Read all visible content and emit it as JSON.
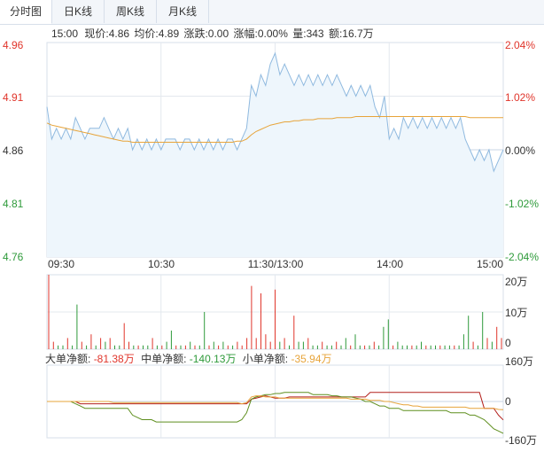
{
  "tabs": [
    {
      "label": "分时图",
      "active": true
    },
    {
      "label": "日K线",
      "active": false
    },
    {
      "label": "周K线",
      "active": false
    },
    {
      "label": "月K线",
      "active": false
    }
  ],
  "info": {
    "time": "15:00",
    "price": "现价:4.86",
    "avg": "均价:4.89",
    "change": "涨跌:0.00",
    "pct": "涨幅:0.00%",
    "volume": "量:343",
    "amount": "额:16.7万"
  },
  "flow": {
    "large_label": "大单净额:",
    "large_value": "-81.38万",
    "medium_label": "中单净额:",
    "medium_value": "-140.13万",
    "small_label": "小单净额:",
    "small_value": "-35.94万"
  },
  "colors": {
    "up": "#e0352b",
    "down": "#2e9a3a",
    "price_line": "#8fb9df",
    "avg_line": "#e7a43a",
    "area": "#eef6fc",
    "grid": "#e3e8ee",
    "large": "#b3201c",
    "medium": "#5f8f1f",
    "small": "#e7a43a"
  },
  "chart_data": [
    {
      "type": "line",
      "name": "price",
      "ylim": [
        4.76,
        4.96
      ],
      "ticks_left": [
        "4.96",
        "4.91",
        "4.86",
        "4.81",
        "4.76"
      ],
      "ticks_right": [
        "2.04%",
        "1.02%",
        "0.00%",
        "-1.02%",
        "-2.04%"
      ],
      "x_labels": [
        "09:30",
        "10:30",
        "11:30/13:00",
        "14:00",
        "15:00"
      ],
      "prev_close": 4.86,
      "price": [
        4.9,
        4.87,
        4.88,
        4.87,
        4.88,
        4.87,
        4.89,
        4.88,
        4.87,
        4.88,
        4.88,
        4.88,
        4.89,
        4.88,
        4.87,
        4.88,
        4.87,
        4.88,
        4.86,
        4.87,
        4.86,
        4.87,
        4.86,
        4.87,
        4.86,
        4.87,
        4.87,
        4.87,
        4.86,
        4.87,
        4.87,
        4.86,
        4.87,
        4.86,
        4.87,
        4.86,
        4.87,
        4.86,
        4.87,
        4.87,
        4.86,
        4.87,
        4.88,
        4.92,
        4.91,
        4.93,
        4.92,
        4.94,
        4.95,
        4.93,
        4.94,
        4.93,
        4.92,
        4.93,
        4.92,
        4.93,
        4.92,
        4.93,
        4.92,
        4.93,
        4.92,
        4.93,
        4.92,
        4.91,
        4.92,
        4.91,
        4.92,
        4.91,
        4.92,
        4.9,
        4.89,
        4.91,
        4.87,
        4.88,
        4.87,
        4.89,
        4.88,
        4.89,
        4.88,
        4.89,
        4.88,
        4.89,
        4.88,
        4.89,
        4.88,
        4.89,
        4.88,
        4.89,
        4.87,
        4.86,
        4.85,
        4.86,
        4.85,
        4.86,
        4.84,
        4.85,
        4.86
      ],
      "avg": [
        4.885,
        4.883,
        4.882,
        4.881,
        4.88,
        4.879,
        4.878,
        4.877,
        4.876,
        4.875,
        4.874,
        4.873,
        4.872,
        4.871,
        4.87,
        4.869,
        4.868,
        4.868,
        4.867,
        4.867,
        4.867,
        4.867,
        4.867,
        4.867,
        4.867,
        4.867,
        4.867,
        4.867,
        4.867,
        4.867,
        4.867,
        4.867,
        4.867,
        4.867,
        4.867,
        4.867,
        4.867,
        4.867,
        4.867,
        4.867,
        4.868,
        4.868,
        4.87,
        4.874,
        4.877,
        4.879,
        4.881,
        4.883,
        4.884,
        4.885,
        4.886,
        4.886,
        4.887,
        4.887,
        4.888,
        4.888,
        4.888,
        4.889,
        4.889,
        4.889,
        4.889,
        4.89,
        4.89,
        4.89,
        4.89,
        4.891,
        4.891,
        4.891,
        4.891,
        4.891,
        4.891,
        4.891,
        4.891,
        4.891,
        4.891,
        4.891,
        4.891,
        4.891,
        4.891,
        4.891,
        4.891,
        4.891,
        4.891,
        4.891,
        4.891,
        4.891,
        4.891,
        4.891,
        4.891,
        4.89,
        4.89,
        4.89,
        4.89,
        4.89,
        4.89,
        4.89,
        4.89
      ]
    },
    {
      "type": "bar",
      "name": "volume",
      "ylim": [
        0,
        20
      ],
      "ticks_right": [
        "20万",
        "10万",
        "0"
      ],
      "volume": [
        20,
        2,
        1,
        1,
        3,
        1,
        12,
        2,
        1,
        4,
        1,
        3,
        2,
        3,
        1,
        1,
        7,
        2,
        1,
        1,
        1,
        1,
        3,
        1,
        1,
        2,
        5,
        1,
        1,
        1,
        2,
        1,
        1,
        10,
        1,
        2,
        1,
        2,
        1,
        1,
        2,
        1,
        3,
        17,
        3,
        15,
        4,
        2,
        16,
        2,
        3,
        1,
        9,
        2,
        2,
        3,
        1,
        1,
        2,
        1,
        1,
        2,
        1,
        3,
        1,
        4,
        1,
        1,
        1,
        2,
        1,
        6,
        8,
        1,
        2,
        1,
        1,
        1,
        1,
        2,
        1,
        1,
        1,
        1,
        1,
        1,
        1,
        1,
        4,
        9,
        2,
        1,
        10,
        3,
        2,
        6,
        3
      ],
      "volume_dir": [
        1,
        1,
        0,
        0,
        1,
        0,
        0,
        1,
        0,
        1,
        0,
        1,
        0,
        1,
        0,
        0,
        1,
        1,
        0,
        1,
        0,
        0,
        1,
        0,
        1,
        0,
        0,
        1,
        0,
        1,
        0,
        1,
        0,
        0,
        1,
        0,
        1,
        0,
        1,
        0,
        1,
        1,
        1,
        1,
        1,
        1,
        1,
        1,
        1,
        0,
        1,
        0,
        1,
        0,
        0,
        1,
        0,
        0,
        1,
        0,
        0,
        1,
        0,
        0,
        1,
        0,
        0,
        1,
        0,
        1,
        0,
        0,
        0,
        1,
        0,
        0,
        0,
        1,
        0,
        0,
        1,
        0,
        0,
        1,
        0,
        0,
        1,
        0,
        0,
        0,
        1,
        0,
        0,
        1,
        0,
        1,
        1
      ]
    },
    {
      "type": "line",
      "name": "net_flow",
      "ylim": [
        -160,
        160
      ],
      "ticks_right": [
        "160万",
        "0",
        "-160万"
      ],
      "large": [
        0,
        0,
        0,
        0,
        0,
        0,
        0,
        -10,
        -10,
        -10,
        -10,
        -10,
        -10,
        -10,
        -10,
        -10,
        -10,
        -10,
        -10,
        -10,
        -10,
        -10,
        -10,
        -10,
        -10,
        -10,
        -10,
        -10,
        -10,
        -10,
        -10,
        -10,
        -10,
        -10,
        -10,
        -10,
        -10,
        -10,
        -10,
        -10,
        -10,
        -10,
        -10,
        10,
        15,
        20,
        25,
        20,
        15,
        15,
        15,
        20,
        20,
        20,
        20,
        20,
        20,
        20,
        20,
        20,
        20,
        20,
        20,
        20,
        20,
        20,
        20,
        20,
        40,
        40,
        40,
        40,
        40,
        40,
        40,
        40,
        40,
        40,
        40,
        40,
        40,
        40,
        40,
        40,
        40,
        40,
        40,
        40,
        40,
        40,
        40,
        40,
        -30,
        -30,
        -30,
        -60,
        -81
      ],
      "medium": [
        0,
        0,
        0,
        0,
        0,
        0,
        -10,
        -20,
        -30,
        -30,
        -30,
        -30,
        -30,
        -30,
        -30,
        -30,
        -30,
        -30,
        -60,
        -70,
        -80,
        -80,
        -80,
        -90,
        -90,
        -90,
        -90,
        -90,
        -90,
        -90,
        -90,
        -90,
        -90,
        -90,
        -90,
        -90,
        -90,
        -90,
        -90,
        -90,
        -90,
        -80,
        -50,
        10,
        20,
        25,
        30,
        30,
        35,
        35,
        40,
        40,
        40,
        40,
        40,
        40,
        30,
        30,
        30,
        30,
        25,
        25,
        20,
        20,
        20,
        15,
        10,
        0,
        0,
        -10,
        -20,
        -20,
        -30,
        -30,
        -30,
        -40,
        -40,
        -40,
        -40,
        -40,
        -40,
        -40,
        -40,
        -40,
        -40,
        -50,
        -50,
        -50,
        -50,
        -60,
        -60,
        -70,
        -80,
        -100,
        -120,
        -130,
        -140
      ],
      "small": [
        0,
        0,
        0,
        0,
        0,
        0,
        0,
        0,
        0,
        0,
        0,
        0,
        0,
        0,
        -5,
        -5,
        -5,
        -5,
        -5,
        -5,
        -5,
        -5,
        -5,
        -5,
        -5,
        -5,
        -5,
        -5,
        -5,
        -5,
        -5,
        -5,
        -5,
        -5,
        -5,
        -5,
        -5,
        -5,
        -5,
        -5,
        -5,
        -10,
        -5,
        20,
        25,
        25,
        20,
        20,
        20,
        15,
        15,
        15,
        15,
        15,
        15,
        15,
        15,
        15,
        15,
        15,
        15,
        15,
        15,
        15,
        10,
        10,
        10,
        10,
        5,
        5,
        5,
        0,
        0,
        -5,
        -10,
        -15,
        -15,
        -20,
        -20,
        -25,
        -25,
        -25,
        -25,
        -25,
        -25,
        -25,
        -25,
        -25,
        -25,
        -30,
        -30,
        -30,
        -30,
        -30,
        -30,
        -35,
        -36
      ]
    }
  ]
}
